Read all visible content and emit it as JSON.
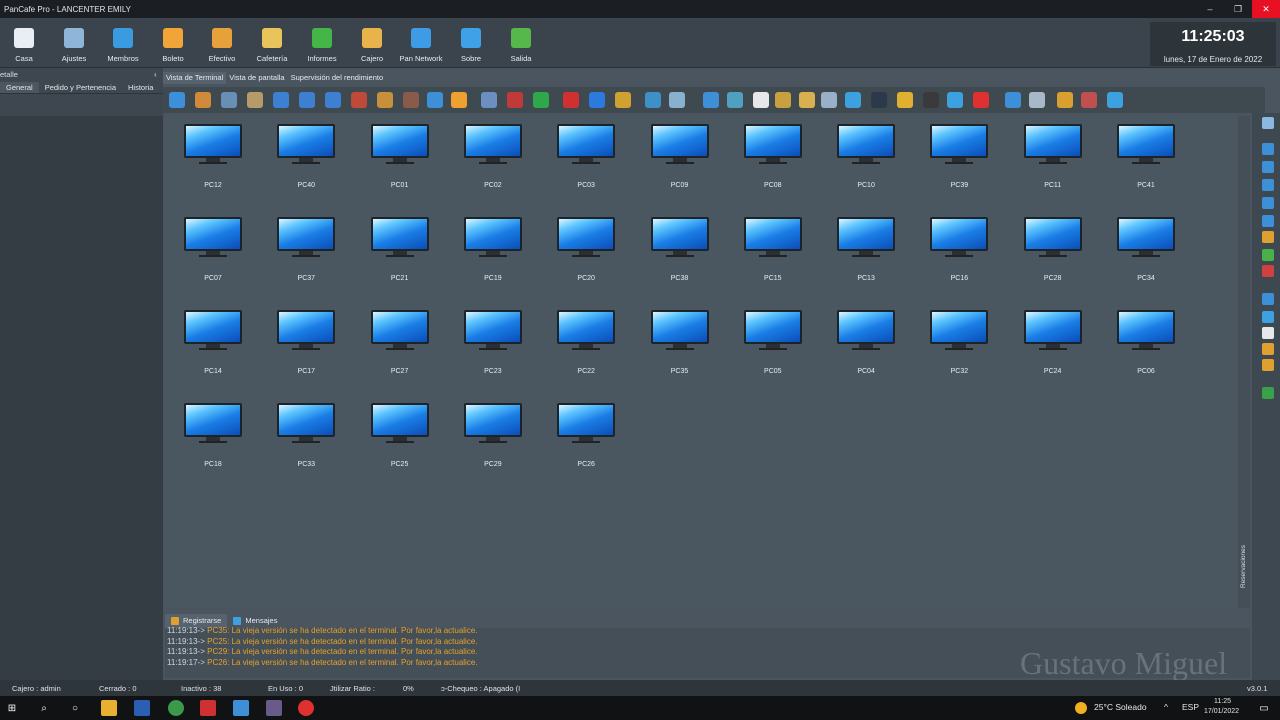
{
  "window": {
    "title": "PanCafe Pro - LANCENTER EMILY",
    "minimize": "–",
    "maximize": "❐",
    "close": "✕"
  },
  "topbar": [
    {
      "label": "Casa",
      "color": "#e8eef3"
    },
    {
      "label": "Ajustes",
      "color": "#8fb5d9"
    },
    {
      "label": "Membros",
      "color": "#3b9be0"
    },
    {
      "label": "Boleto",
      "color": "#f1a437"
    },
    {
      "label": "Efectivo",
      "color": "#e7a13a"
    },
    {
      "label": "Cafetería",
      "color": "#e8c45a"
    },
    {
      "label": "Informes",
      "color": "#44b648"
    },
    {
      "label": "Cajero",
      "color": "#e8b34a"
    },
    {
      "label": "Pan Network",
      "color": "#3e9be6"
    },
    {
      "label": "Sobre",
      "color": "#3fa1e8"
    },
    {
      "label": "Salida",
      "color": "#56b84a"
    }
  ],
  "clock": {
    "time": "11:25:03",
    "date": "lunes, 17 de Enero de 2022"
  },
  "left": {
    "header": "etalle",
    "collapse": "‹",
    "tabs": [
      "General",
      "Pedido y Pertenencia",
      "Historia"
    ]
  },
  "view_tabs": [
    "Vista de Terminal",
    "Vista de pantalla",
    "Supervisión del rendimiento"
  ],
  "toolbar_colors": [
    "#3d8fdb",
    "#d08a3a",
    "#6a8fb5",
    "#b59a6a",
    "#3d7fd0",
    "#3d7fd0",
    "#3d7fd0",
    "#c04a3a",
    "#c7903a",
    "#8a5a4a",
    "#3d90d8",
    "#f0a030",
    "#6a8fc0",
    "#c03a3a",
    "#2fa84a",
    "#d03030",
    "#2a7ae0",
    "#d0a030",
    "#3d90c8",
    "#8ab0d0",
    "#3d90d8",
    "#50a0c0",
    "#e8e8e8",
    "#c9a040",
    "#d8b050",
    "#9ab0c8",
    "#3da0e0",
    "#2a3a4a",
    "#e0b030",
    "#3a3a3a",
    "#3da0e0",
    "#e03030",
    "#3d90d8",
    "#a8b8c8",
    "#d8a030",
    "#c05050",
    "#3da0e0"
  ],
  "terminals": [
    [
      "PC12",
      "PC40",
      "PC01",
      "PC02",
      "PC03",
      "PC09",
      "PC08",
      "PC10",
      "PC39",
      "PC11",
      "PC41"
    ],
    [
      "PC07",
      "PC37",
      "PC21",
      "PC19",
      "PC20",
      "PC38",
      "PC15",
      "PC13",
      "PC16",
      "PC28",
      "PC34"
    ],
    [
      "PC14",
      "PC17",
      "PC27",
      "PC23",
      "PC22",
      "PC35",
      "PC05",
      "PC04",
      "PC32",
      "PC24",
      "PC06"
    ],
    [
      "PC18",
      "PC33",
      "PC25",
      "PC29",
      "PC26"
    ]
  ],
  "right_strip": {
    "label": "Reservaciones",
    "icon_colors": [
      "#8ab8e0",
      "#3d90d8",
      "#3d90d8",
      "#3d90d8",
      "#3d90d8",
      "#3d90d8",
      "#e0a030",
      "#4ab04a",
      "#d04040",
      "#3d90d8",
      "#3da0e0",
      "#e8e8e8",
      "#e0a030",
      "#e0a030",
      "#3aa04a"
    ]
  },
  "log": {
    "tabs": [
      {
        "label": "Registrarse",
        "color": "#e0a030"
      },
      {
        "label": "Mensajes",
        "color": "#3da0e0"
      }
    ],
    "lines": [
      {
        "time": "11:19:13->",
        "msg": "PC35: La vieja versión se ha detectado en el terminal. Por favor,la actualice."
      },
      {
        "time": "11:19:13->",
        "msg": "PC25: La vieja versión se ha detectado en el terminal. Por favor,la actualice."
      },
      {
        "time": "11:19:13->",
        "msg": "PC29: La vieja versión se ha detectado en el terminal. Por favor,la actualice."
      },
      {
        "time": "11:19:17->",
        "msg": "PC26: La vieja versión se ha detectado en el terminal. Por favor,la actualice."
      }
    ]
  },
  "watermark": "Gustavo Miguel",
  "status": {
    "cajero": "Cajero : admin",
    "cerrado": "Cerrado : 0",
    "inactivo": "Inactivo : 38",
    "enuso": "En Uso : 0",
    "ratio": "Jtilizar Ratio :",
    "ratio_val": "0%",
    "chequeo": "ɔ-Chequeo : Apagado (I",
    "version": "v3.0.1"
  },
  "taskbar": {
    "weather": "25°C  Soleado",
    "lang": "ESP",
    "time": "11:25",
    "date": "17/01/2022",
    "caret": "^"
  }
}
